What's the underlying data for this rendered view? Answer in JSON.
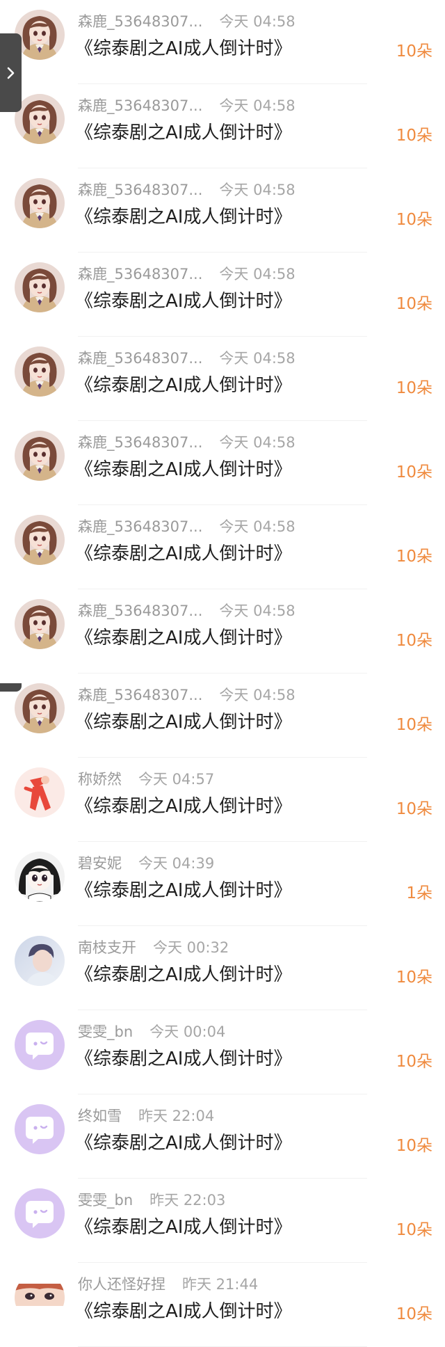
{
  "items": [
    {
      "name": "森鹿_53648307...",
      "time": "今天 04:58",
      "title": "《综泰剧之AI成人倒计时》",
      "amount": "10朵",
      "avatar": "anime-girl-avatar"
    },
    {
      "name": "森鹿_53648307...",
      "time": "今天 04:58",
      "title": "《综泰剧之AI成人倒计时》",
      "amount": "10朵",
      "avatar": "anime-girl-avatar"
    },
    {
      "name": "森鹿_53648307...",
      "time": "今天 04:58",
      "title": "《综泰剧之AI成人倒计时》",
      "amount": "10朵",
      "avatar": "anime-girl-avatar"
    },
    {
      "name": "森鹿_53648307...",
      "time": "今天 04:58",
      "title": "《综泰剧之AI成人倒计时》",
      "amount": "10朵",
      "avatar": "anime-girl-avatar"
    },
    {
      "name": "森鹿_53648307...",
      "time": "今天 04:58",
      "title": "《综泰剧之AI成人倒计时》",
      "amount": "10朵",
      "avatar": "anime-girl-avatar"
    },
    {
      "name": "森鹿_53648307...",
      "time": "今天 04:58",
      "title": "《综泰剧之AI成人倒计时》",
      "amount": "10朵",
      "avatar": "anime-girl-avatar"
    },
    {
      "name": "森鹿_53648307...",
      "time": "今天 04:58",
      "title": "《综泰剧之AI成人倒计时》",
      "amount": "10朵",
      "avatar": "anime-girl-avatar"
    },
    {
      "name": "森鹿_53648307...",
      "time": "今天 04:58",
      "title": "《综泰剧之AI成人倒计时》",
      "amount": "10朵",
      "avatar": "anime-girl-avatar"
    },
    {
      "name": "森鹿_53648307...",
      "time": "今天 04:58",
      "title": "《综泰剧之AI成人倒计时》",
      "amount": "10朵",
      "avatar": "anime-girl-avatar"
    },
    {
      "name": "称娇然",
      "time": "今天 04:57",
      "title": "《综泰剧之AI成人倒计时》",
      "amount": "10朵",
      "avatar": "cartoon-figure-avatar"
    },
    {
      "name": "碧安妮",
      "time": "今天 04:39",
      "title": "《综泰剧之AI成人倒计时》",
      "amount": "1朵",
      "avatar": "manga-girl-avatar"
    },
    {
      "name": "南枝支开",
      "time": "今天 00:32",
      "title": "《综泰剧之AI成人倒计时》",
      "amount": "10朵",
      "avatar": "photo-boy-avatar"
    },
    {
      "name": "雯雯_bn",
      "time": "今天 00:04",
      "title": "《综泰剧之AI成人倒计时》",
      "amount": "10朵",
      "avatar": "default-chat-avatar"
    },
    {
      "name": "终如雪",
      "time": "昨天 22:04",
      "title": "《综泰剧之AI成人倒计时》",
      "amount": "10朵",
      "avatar": "default-chat-avatar"
    },
    {
      "name": "雯雯_bn",
      "time": "昨天 22:03",
      "title": "《综泰剧之AI成人倒计时》",
      "amount": "10朵",
      "avatar": "default-chat-avatar"
    },
    {
      "name": "你人还怪好捏",
      "time": "昨天 21:44",
      "title": "《综泰剧之AI成人倒计时》",
      "amount": "10朵",
      "avatar": "anime-face-avatar"
    }
  ],
  "colors": {
    "amount": "#ef8a3e",
    "meta": "#9a9a9a",
    "title": "#1f1f1f",
    "side_tab": "#4a4a4a",
    "default_avatar": "#d9c5f3"
  },
  "side_tab_icon": "chevron-right-icon"
}
